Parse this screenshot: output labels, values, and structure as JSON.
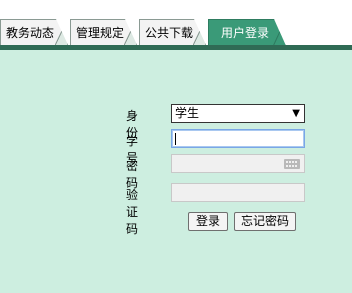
{
  "tabs": [
    {
      "label": "教务动态",
      "active": false
    },
    {
      "label": "管理规定",
      "active": false
    },
    {
      "label": "公共下载",
      "active": false
    },
    {
      "label": "用户登录",
      "active": true
    }
  ],
  "login": {
    "identity_label": "身 份",
    "identity_value": "学生",
    "student_id_label": "学 号",
    "student_id_value": "",
    "password_label": "密 码",
    "password_value": "",
    "captcha_label": "验证码",
    "captcha_value": "",
    "login_button": "登录",
    "forgot_button": "忘记密码",
    "dropdown_arrow": "▼"
  },
  "colors": {
    "background": "#cdeee0",
    "active_tab": "#3a9a78",
    "tab_strip": "#2f6b55"
  },
  "icons": {
    "dropdown": "chevron-down-icon",
    "keyboard": "keyboard-icon"
  }
}
